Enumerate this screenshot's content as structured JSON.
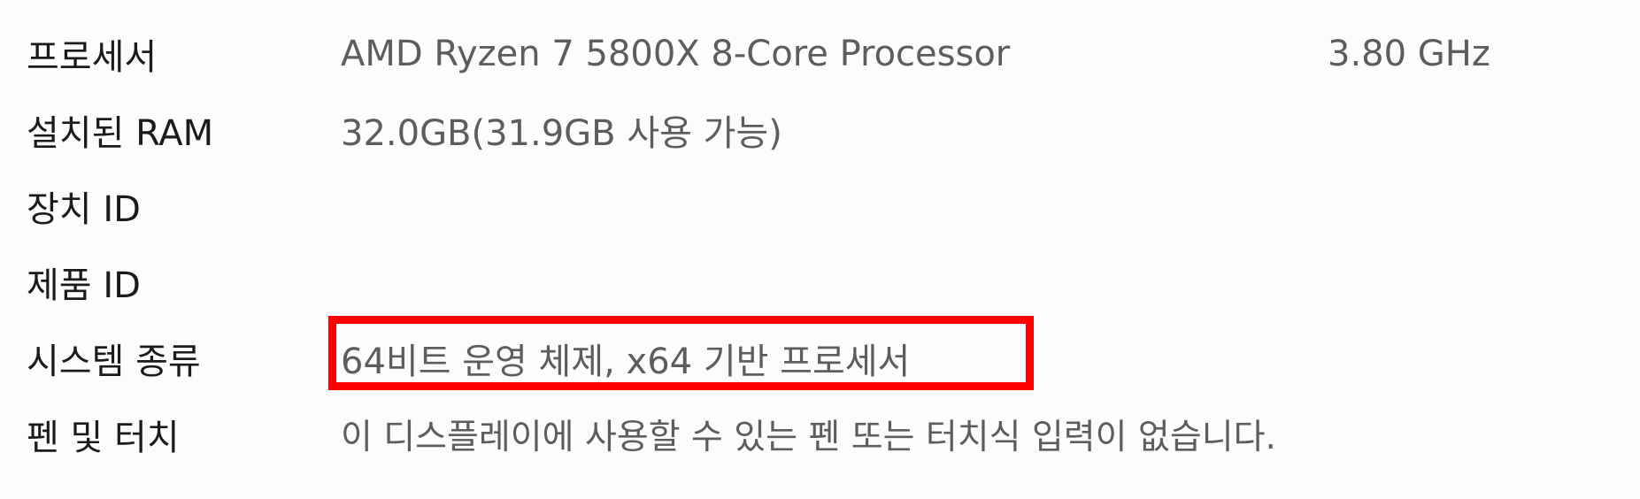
{
  "specs": [
    {
      "label": "프로세서",
      "value": "AMD Ryzen 7 5800X 8-Core Processor",
      "extra": "3.80 GHz"
    },
    {
      "label": "설치된 RAM",
      "value": "32.0GB(31.9GB 사용 가능)"
    },
    {
      "label": "장치 ID",
      "value": ""
    },
    {
      "label": "제품 ID",
      "value": ""
    },
    {
      "label": "시스템 종류",
      "value": "64비트 운영 체제, x64 기반 프로세서"
    },
    {
      "label": "펜 및 터치",
      "value": "이 디스플레이에 사용할 수 있는 펜 또는 터치식 입력이 없습니다."
    }
  ],
  "colors": {
    "label": "#1b1b1b",
    "value": "#5d5d5d",
    "highlight": "#ff0000"
  }
}
